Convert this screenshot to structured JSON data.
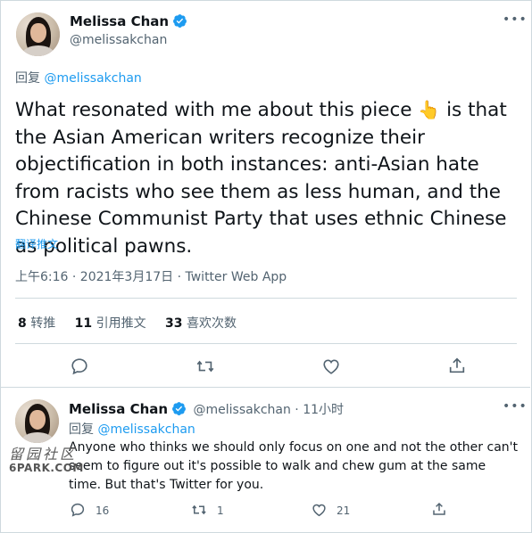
{
  "main_tweet": {
    "author_name": "Melissa Chan",
    "handle": "@melissakchan",
    "reply_label": "回复",
    "reply_to": "@melissakchan",
    "text_before_emoji": "What resonated with me about this piece",
    "emoji": "👆",
    "text_after_emoji": " is that the Asian American writers recognize their objectification in both instances: anti-Asian hate from racists who see them as less human, and the Chinese Communist Party that uses ethnic Chinese as political pawns.",
    "translate_label": "翻译推文",
    "timestamp": "上午6:16 · 2021年3月17日 · Twitter Web App",
    "stats": {
      "retweets_count": "8",
      "retweets_label": "转推",
      "quotes_count": "11",
      "quotes_label": "引用推文",
      "likes_count": "33",
      "likes_label": "喜欢次数"
    }
  },
  "reply_tweet": {
    "author_name": "Melissa Chan",
    "handle_time": "@melissakchan · 11小时",
    "reply_label": "回复",
    "reply_to": "@melissakchan",
    "text": "Anyone who thinks we should only focus on one and not the other can't seem to figure out it's possible to walk and chew gum at the same time. But that's Twitter for you.",
    "reply_count": "16",
    "retweet_count": "1",
    "like_count": "21"
  },
  "watermark": {
    "line1": "留园社区",
    "line2": "6PARK.COM"
  },
  "colors": {
    "accent": "#1d9bf0",
    "text": "#0f1419",
    "secondary": "#536471",
    "border": "#cfd9de"
  },
  "icons": [
    "verified-badge-icon",
    "more-icon",
    "reply-icon",
    "retweet-icon",
    "like-icon",
    "share-icon"
  ]
}
